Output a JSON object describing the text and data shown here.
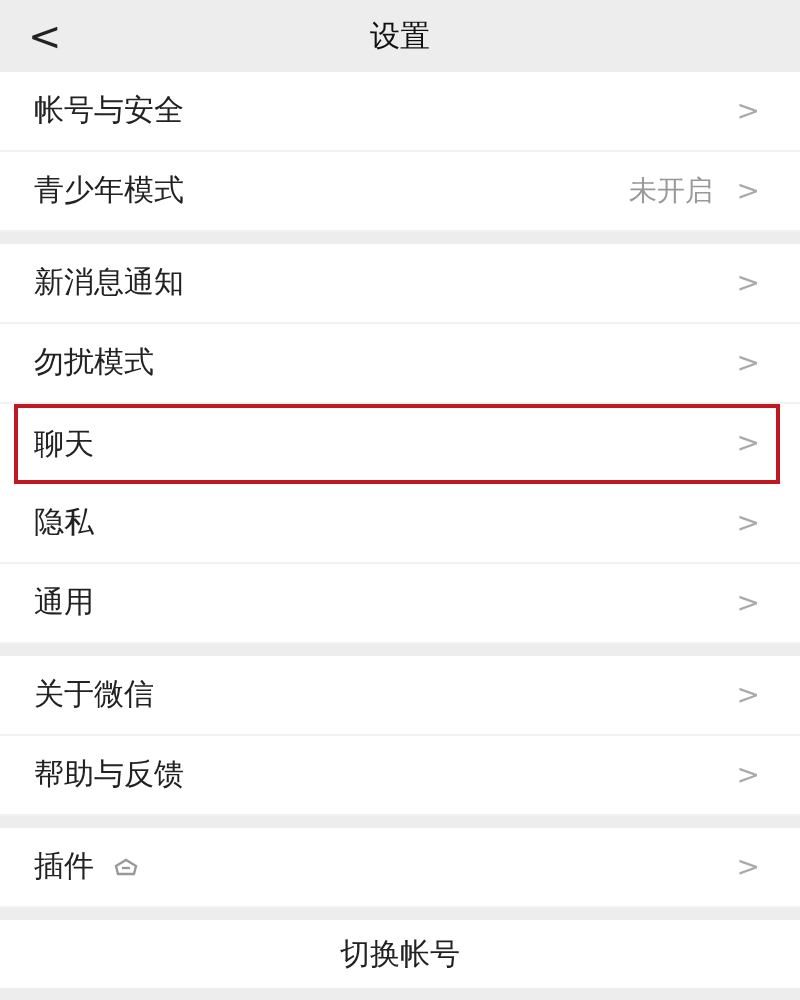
{
  "header": {
    "back": "<",
    "title": "设置"
  },
  "sections": [
    {
      "items": [
        {
          "label": "帐号与安全",
          "chevron": ">",
          "highlighted": false
        },
        {
          "label": "青少年模式",
          "value": "未开启",
          "chevron": ">",
          "highlighted": false
        }
      ]
    },
    {
      "items": [
        {
          "label": "新消息通知",
          "chevron": ">",
          "highlighted": false
        },
        {
          "label": "勿扰模式",
          "chevron": ">",
          "highlighted": false
        },
        {
          "label": "聊天",
          "chevron": ">",
          "highlighted": true
        },
        {
          "label": "隐私",
          "chevron": ">",
          "highlighted": false
        },
        {
          "label": "通用",
          "chevron": ">",
          "highlighted": false
        }
      ]
    },
    {
      "items": [
        {
          "label": "关于微信",
          "chevron": ">",
          "highlighted": false
        },
        {
          "label": "帮助与反馈",
          "chevron": ">",
          "highlighted": false
        }
      ]
    },
    {
      "items": [
        {
          "label": "插件",
          "icon": true,
          "chevron": ">",
          "highlighted": false
        }
      ]
    }
  ],
  "switch_account": "切换帐号"
}
